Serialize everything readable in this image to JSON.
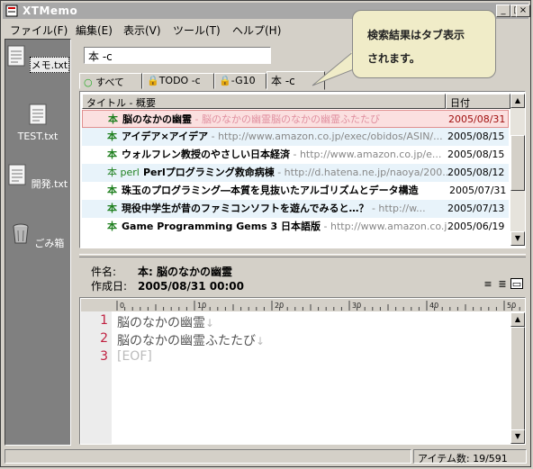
{
  "window": {
    "title": "XTMemo"
  },
  "menu": [
    "ファイル(F)",
    "編集(E)",
    "表示(V)",
    "ツール(T)",
    "ヘルプ(H)"
  ],
  "sidebar": {
    "items": [
      {
        "label": "メモ.txt",
        "icon": "memo-file-icon"
      },
      {
        "label": "TEST.txt",
        "icon": "memo-file-icon"
      },
      {
        "label": "開発.txt",
        "icon": "memo-file-icon"
      },
      {
        "label": "ごみ箱",
        "icon": "trash-icon"
      }
    ]
  },
  "search": {
    "value": "本 -c"
  },
  "tabs": [
    {
      "label": "すべて",
      "icon": "circle-icon"
    },
    {
      "label": "TODO -c",
      "icon": "lock-icon"
    },
    {
      "label": "-G10",
      "icon": "lock-icon"
    },
    {
      "label": "本 -c",
      "icon": ""
    }
  ],
  "list": {
    "columns": [
      "タイトル - 概要",
      "日付"
    ],
    "rows": [
      {
        "icon": "本",
        "title": "脳のなかの幽霊",
        "summary": " - 脳のなかの幽霊脳のなかの幽霊ふたたび",
        "date": "2005/08/31"
      },
      {
        "icon": "本",
        "title": "アイデア×アイデア",
        "summary": " - http://www.amazon.co.jp/exec/obidos/ASIN/...",
        "date": "2005/08/15"
      },
      {
        "icon": "本",
        "title": "ウォルフレン教授のやさしい日本経済",
        "summary": " - http://www.amazon.co.jp/e...",
        "date": "2005/08/15"
      },
      {
        "icon": "本 perl",
        "title": "Perlプログラミング救命病棟",
        "summary": " - http://d.hatena.ne.jp/naoya/200...",
        "date": "2005/08/12"
      },
      {
        "icon": "本",
        "title": "珠玉のプログラミング―本質を見抜いたアルゴリズムとデータ構造",
        "summary": "",
        "date": "2005/07/31"
      },
      {
        "icon": "本",
        "title": "現役中学生が昔のファミコンソフトを遊んでみると…？",
        "summary": " - http://w...",
        "date": "2005/07/13"
      },
      {
        "icon": "本",
        "title": "Game Programming Gems 3 日本語版",
        "summary": " - http://www.amazon.co.j...",
        "date": "2005/06/19"
      }
    ]
  },
  "detail": {
    "subject_label": "件名:",
    "subject": "本: 脳のなかの幽霊",
    "created_label": "作成日:",
    "created": "2005/08/31 00:00"
  },
  "editor": {
    "lines": [
      "脳のなかの幽霊",
      "脳のなかの幽霊ふたたび",
      "[EOF]"
    ],
    "eol": "↓",
    "ruler_marks": [
      "0",
      "10",
      "20",
      "30",
      "40",
      "50"
    ]
  },
  "status": {
    "count": "アイテム数: 19/591"
  },
  "callout": {
    "line1": "検索結果はタブ表示",
    "line2": "されます。"
  }
}
